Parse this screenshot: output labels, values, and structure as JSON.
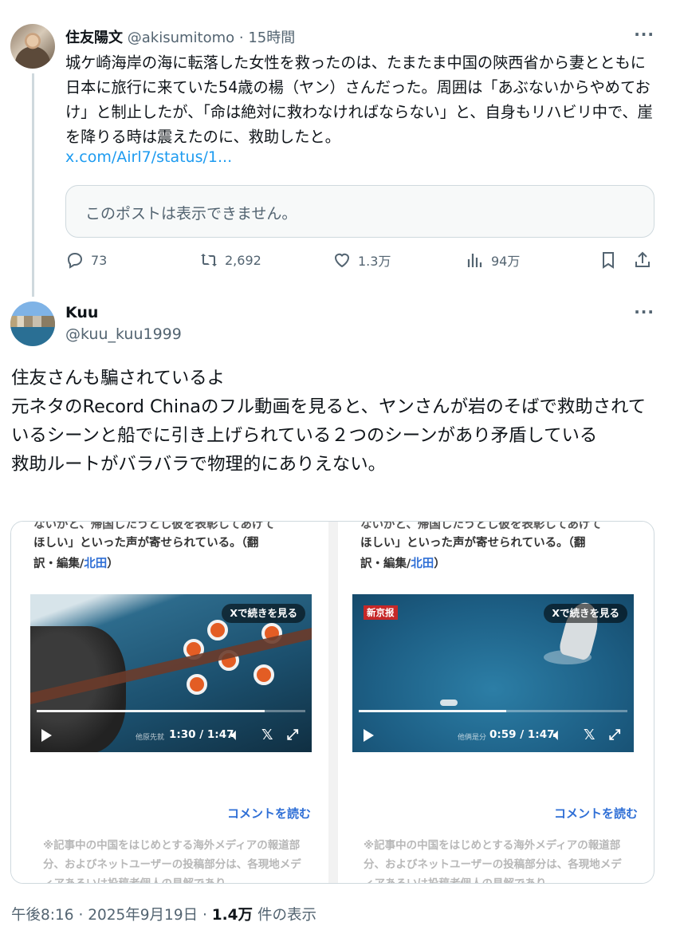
{
  "tweet1": {
    "author_name": "住友陽文",
    "handle": "@akisumitomo",
    "separator": "·",
    "time": "15時間",
    "more": "···",
    "body": "城ケ崎海岸の海に転落した女性を救ったのは、たまたま中国の陝西省から妻とともに日本に旅行に来ていた54歳の楊（ヤン）さんだった。周囲は「あぶないからやめておけ」と制止したが、「命は絶対に救わなければならない」と、自身もリハビリ中で、崖を降りる時は震えたのに、救助したと。",
    "link": "x.com/Airl7/status/1...",
    "quote_unavailable": "このポストは表示できません。",
    "actions": {
      "replies": "73",
      "reposts": "2,692",
      "likes": "1.3万",
      "views": "94万"
    }
  },
  "tweet2": {
    "author_name": "Kuu",
    "handle": "@kuu_kuu1999",
    "more": "···",
    "body_lines": [
      "住友さんも騙されているよ",
      "元ネタのRecord Chinaのフル動画を見ると、ヤンさんが岩のそばで救助されているシーンと船でに引き上げられている２つのシーンがあり矛盾している",
      "救助ルートがバラバラで物理的にありえない。"
    ],
    "media": [
      {
        "cut_text": "ないがと、帰国したうとし彼を表彰してあげて",
        "text_line1": "ほしい」といった声が寄せられている。（翻",
        "text_line2_prefix": "訳・編集/",
        "text_line2_link": "北田",
        "text_line2_suffix": "）",
        "video_button": "Xで続きを見る",
        "credit": "他原先就",
        "time": "1:30 / 1:47",
        "progress": 0.85,
        "comment_link": "コメントを読む",
        "note": "※記事中の中国をはじめとする海外メディアの報道部分、およびネットユーザーの投稿部分は、各現地メディアあるいは投稿者個人の見解であり、"
      },
      {
        "cut_text": "ないがと、帰国したうとし彼を表彰してあげて",
        "text_line1": "ほしい」といった声が寄せられている。（翻",
        "text_line2_prefix": "訳・編集/",
        "text_line2_link": "北田",
        "text_line2_suffix": "）",
        "badge": "新京报",
        "video_button": "Xで続きを見る",
        "credit": "他俩是分",
        "time": "0:59 / 1:47",
        "progress": 0.55,
        "comment_link": "コメントを読む",
        "note": "※記事中の中国をはじめとする海外メディアの報道部分、およびネットユーザーの投稿部分は、各現地メディアあるいは投稿者個人の見解であり、"
      }
    ],
    "footer": {
      "time": "午後8:16",
      "date": "2025年9月19日",
      "views_count": "1.4万",
      "views_label": "件の表示"
    }
  }
}
